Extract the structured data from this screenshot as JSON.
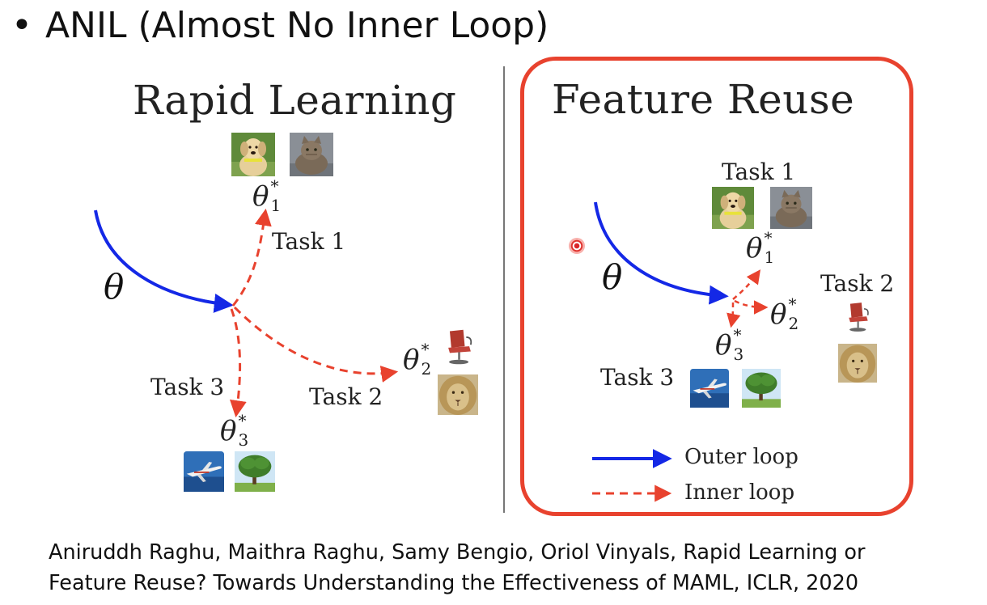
{
  "slide": {
    "bullet": "•",
    "title": "ANIL (Almost No Inner Loop)",
    "citation_line1": "Aniruddh Raghu, Maithra Raghu, Samy Bengio, Oriol Vinyals, Rapid Learning or",
    "citation_line2": "Feature Reuse? Towards Understanding the Effectiveness of MAML, ICLR, 2020"
  },
  "left_panel": {
    "title": "Rapid Learning",
    "theta": "θ",
    "task1_label": "Task 1",
    "task2_label": "Task 2",
    "task3_label": "Task 3",
    "theta_task1": {
      "sym": "θ",
      "sup": "*",
      "sub": "1"
    },
    "theta_task2": {
      "sym": "θ",
      "sup": "*",
      "sub": "2"
    },
    "theta_task3": {
      "sym": "θ",
      "sup": "*",
      "sub": "3"
    }
  },
  "right_panel": {
    "title": "Feature Reuse",
    "theta": "θ",
    "task1_label": "Task 1",
    "task2_label": "Task 2",
    "task3_label": "Task 3",
    "theta_task1": {
      "sym": "θ",
      "sup": "*",
      "sub": "1"
    },
    "theta_task2": {
      "sym": "θ",
      "sup": "*",
      "sub": "2"
    },
    "theta_task3": {
      "sym": "θ",
      "sup": "*",
      "sub": "3"
    },
    "legend_outer": "Outer loop",
    "legend_inner": "Inner loop"
  },
  "colors": {
    "outer_loop": "#1428e6",
    "inner_loop": "#e8422e",
    "highlight_box": "#e8422e"
  },
  "icons": {
    "task1_images": [
      "dog-image-icon",
      "cat-image-icon"
    ],
    "task2_images": [
      "chair-image-icon",
      "lion-image-icon"
    ],
    "task3_images": [
      "airplane-image-icon",
      "tree-image-icon"
    ]
  }
}
